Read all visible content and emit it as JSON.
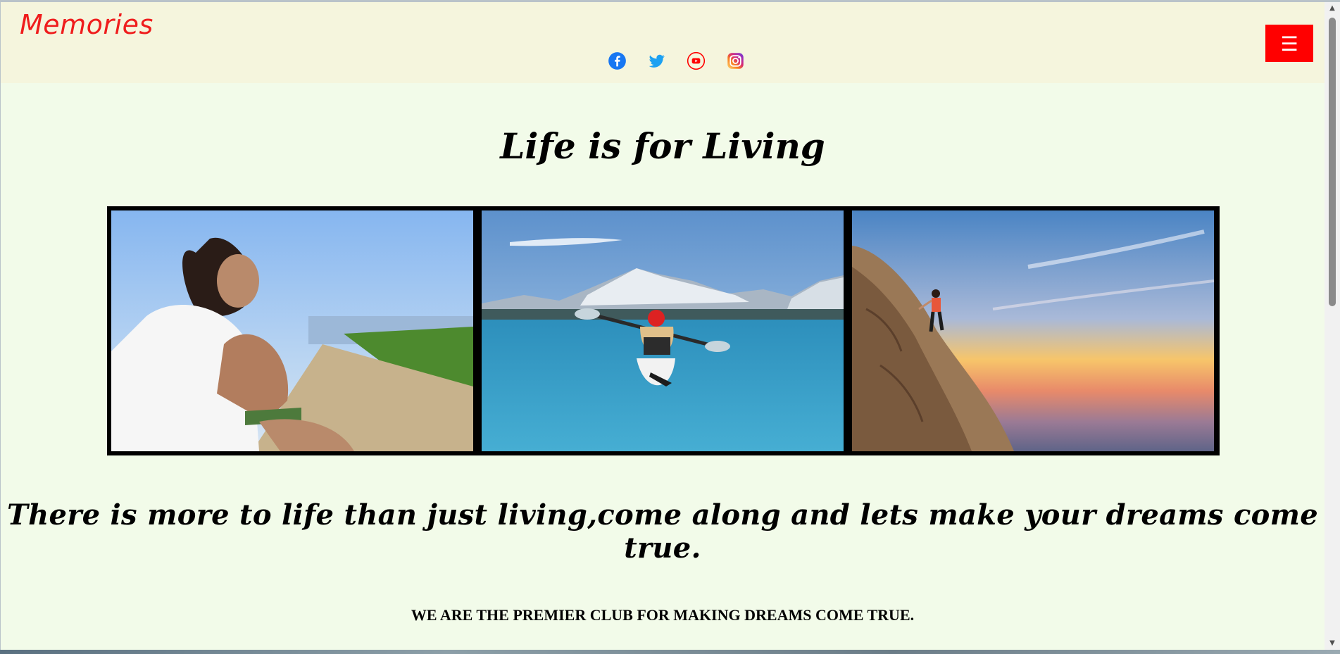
{
  "header": {
    "logo": "Memories",
    "menu_icon": "☰",
    "social": [
      {
        "icon": "facebook-icon",
        "color": "#1877f2"
      },
      {
        "icon": "twitter-icon",
        "color": "#1da1f2"
      },
      {
        "icon": "youtube-icon",
        "color": "#ff0000"
      },
      {
        "icon": "instagram-icon",
        "color": "#c13584"
      }
    ],
    "background": "#f5f5dd",
    "menu_color": "#ff0000",
    "logo_color": "#ef1d1d"
  },
  "main": {
    "headline": "Life is for Living",
    "tagline": "There is more to life than just living,come along and lets make your dreams come true.",
    "motto": "WE ARE THE PREMIER CLUB FOR MAKING DREAMS COME TRUE.",
    "background": "#f2fbe9"
  },
  "gallery": {
    "photos": [
      "woman-by-sea",
      "kayaker-on-lake",
      "climber-at-sunset"
    ]
  },
  "scrollbar": {
    "up": "▲",
    "down": "▼"
  }
}
